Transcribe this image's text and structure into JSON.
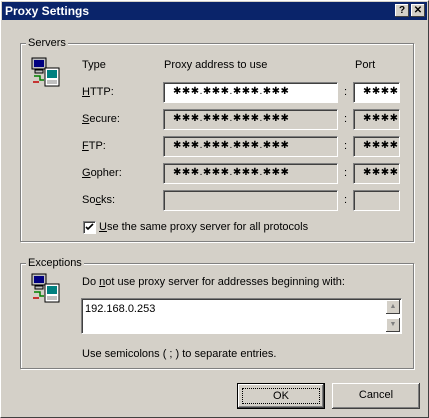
{
  "window": {
    "title": "Proxy Settings",
    "help_glyph": "?",
    "close_glyph": "✕"
  },
  "servers": {
    "legend": "Servers",
    "col_type": "Type",
    "col_address": "Proxy address to use",
    "col_port": "Port",
    "rows": [
      {
        "label_pre": "",
        "label_u": "H",
        "label_post": "TTP:",
        "address": "✱✱✱.✱✱✱.✱✱✱.✱✱✱",
        "port": "✱✱✱✱",
        "enabled": true
      },
      {
        "label_pre": "",
        "label_u": "S",
        "label_post": "ecure:",
        "address": "✱✱✱.✱✱✱.✱✱✱.✱✱✱",
        "port": "✱✱✱✱",
        "enabled": false
      },
      {
        "label_pre": "",
        "label_u": "F",
        "label_post": "TP:",
        "address": "✱✱✱.✱✱✱.✱✱✱.✱✱✱",
        "port": "✱✱✱✱",
        "enabled": false
      },
      {
        "label_pre": "",
        "label_u": "G",
        "label_post": "opher:",
        "address": "✱✱✱.✱✱✱.✱✱✱.✱✱✱",
        "port": "✱✱✱✱",
        "enabled": false
      },
      {
        "label_pre": "So",
        "label_u": "c",
        "label_post": "ks:",
        "address": "",
        "port": "",
        "enabled": false
      }
    ],
    "colon": ":",
    "same_proxy_u": "U",
    "same_proxy_rest": "se the same proxy server for all protocols",
    "same_proxy_checked": true
  },
  "exceptions": {
    "legend": "Exceptions",
    "prompt_pre": "Do ",
    "prompt_u": "n",
    "prompt_post": "ot use proxy server for addresses beginning with:",
    "value": "192.168.0.253",
    "hint": "Use semicolons ( ; ) to separate entries."
  },
  "buttons": {
    "ok": "OK",
    "cancel": "Cancel"
  }
}
